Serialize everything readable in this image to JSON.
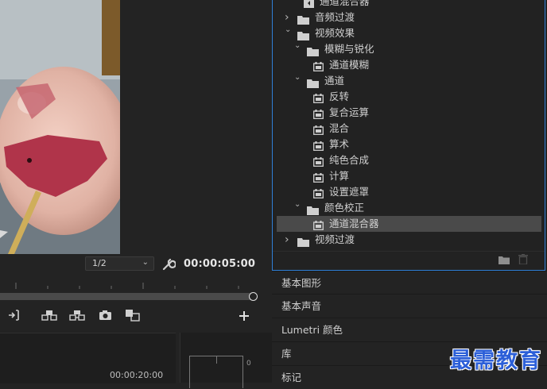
{
  "program_monitor": {
    "playback_resolution": "1/2",
    "current_timecode": "00:00:05:00",
    "sequence_timecode": "00:00:20:00",
    "meter_scale_zero": "0"
  },
  "effects_panel": {
    "items": [
      {
        "label": "通道混合器",
        "type": "effect",
        "level": 1,
        "state": "",
        "partial": true
      },
      {
        "label": "音频过渡",
        "type": "folder",
        "level": 0,
        "state": "collapsed"
      },
      {
        "label": "视频效果",
        "type": "folder",
        "level": 0,
        "state": "expanded"
      },
      {
        "label": "模糊与锐化",
        "type": "folder",
        "level": 1,
        "state": "expanded"
      },
      {
        "label": "通道模糊",
        "type": "effect",
        "level": 2,
        "state": ""
      },
      {
        "label": "通道",
        "type": "folder",
        "level": 1,
        "state": "expanded"
      },
      {
        "label": "反转",
        "type": "effect",
        "level": 2,
        "state": ""
      },
      {
        "label": "复合运算",
        "type": "effect",
        "level": 2,
        "state": ""
      },
      {
        "label": "混合",
        "type": "effect",
        "level": 2,
        "state": ""
      },
      {
        "label": "算术",
        "type": "effect",
        "level": 2,
        "state": ""
      },
      {
        "label": "纯色合成",
        "type": "effect",
        "level": 2,
        "state": ""
      },
      {
        "label": "计算",
        "type": "effect",
        "level": 2,
        "state": ""
      },
      {
        "label": "设置遮罩",
        "type": "effect",
        "level": 2,
        "state": ""
      },
      {
        "label": "颜色校正",
        "type": "folder",
        "level": 1,
        "state": "expanded"
      },
      {
        "label": "通道混合器",
        "type": "effect",
        "level": 2,
        "state": "selected"
      },
      {
        "label": "视频过渡",
        "type": "folder",
        "level": 0,
        "state": "collapsed"
      }
    ]
  },
  "collapsed_panels": [
    "基本图形",
    "基本声音",
    "Lumetri 颜色",
    "库",
    "标记"
  ],
  "watermark": "最需教育",
  "colors": {
    "panel_focus_border": "#2f7fd6",
    "selection_bg": "#4a4a4a",
    "watermark": "#2c5fd8"
  },
  "icons": {
    "folder": "folder-icon",
    "effect": "fx-preset-icon",
    "audio_effect": "audio-fx-icon",
    "settings": "wrench-icon",
    "mark_out": "mark-out-icon",
    "lift": "lift-icon",
    "extract": "extract-icon",
    "export_frame": "camera-icon",
    "compare": "compare-icon",
    "add": "plus-icon",
    "new_bin": "new-bin-icon",
    "delete": "trash-icon"
  }
}
